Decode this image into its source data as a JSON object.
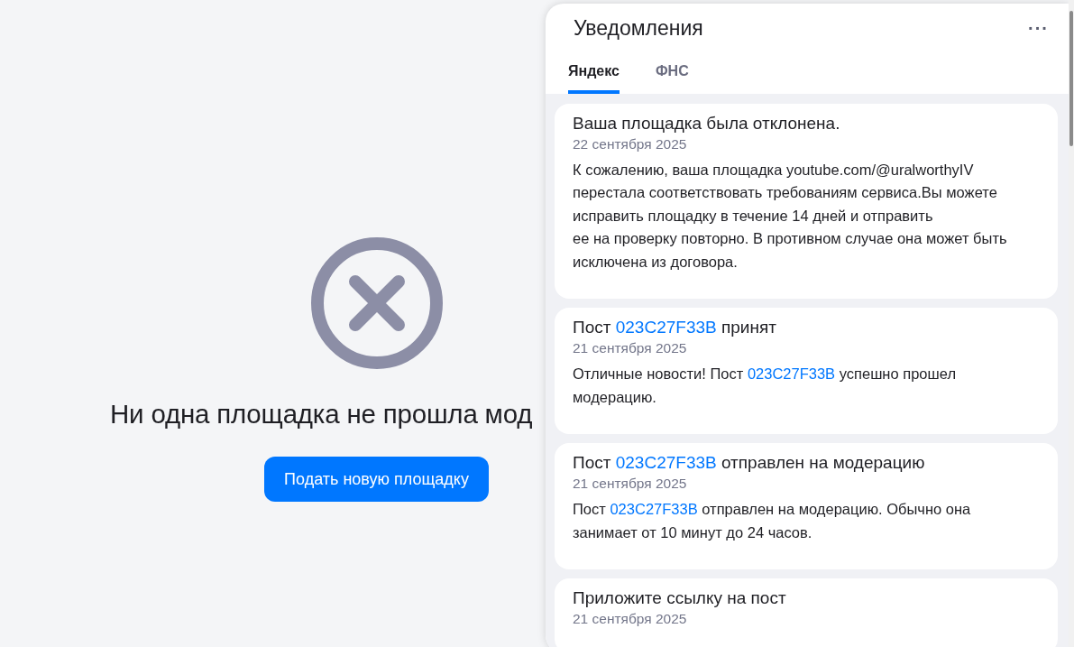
{
  "empty_state": {
    "heading": "Ни одна площадка не прошла мод",
    "button": "Подать новую площадку"
  },
  "notifications": {
    "title": "Уведомления",
    "menu": "···",
    "tabs": [
      {
        "label": "Яндекс",
        "selected": true
      },
      {
        "label": "ФНС",
        "selected": false
      }
    ],
    "items": [
      {
        "title": [
          {
            "kind": "text",
            "text": "Ваша площадка была отклонена."
          }
        ],
        "date": "22 сентября 2025",
        "body": [
          {
            "kind": "text",
            "text": "К сожалению, ваша площадка youtube.com/@uralworthyIV перестала соответствовать требованиям сервиса.Вы можете исправить площадку в течение 14 дней и отправить\nее на проверку повторно. В противном случае она может быть исключена из договора."
          }
        ]
      },
      {
        "title": [
          {
            "kind": "text",
            "text": "Пост "
          },
          {
            "kind": "link",
            "text": "023C27F33B"
          },
          {
            "kind": "text",
            "text": " принят"
          }
        ],
        "date": "21 сентября 2025",
        "body": [
          {
            "kind": "text",
            "text": "Отличные новости! Пост "
          },
          {
            "kind": "link",
            "text": "023C27F33B"
          },
          {
            "kind": "text",
            "text": " успешно прошел модерацию."
          }
        ]
      },
      {
        "title": [
          {
            "kind": "text",
            "text": "Пост "
          },
          {
            "kind": "link",
            "text": "023C27F33B"
          },
          {
            "kind": "text",
            "text": " отправлен на модерацию"
          }
        ],
        "date": "21 сентября 2025",
        "body": [
          {
            "kind": "text",
            "text": "Пост "
          },
          {
            "kind": "link",
            "text": "023C27F33B"
          },
          {
            "kind": "text",
            "text": " отправлен на модерацию. Обычно она занимает от 10 минут до 24 часов."
          }
        ]
      },
      {
        "title": [
          {
            "kind": "text",
            "text": "Приложите ссылку на пост"
          }
        ],
        "date": "21 сентября 2025"
      }
    ]
  }
}
